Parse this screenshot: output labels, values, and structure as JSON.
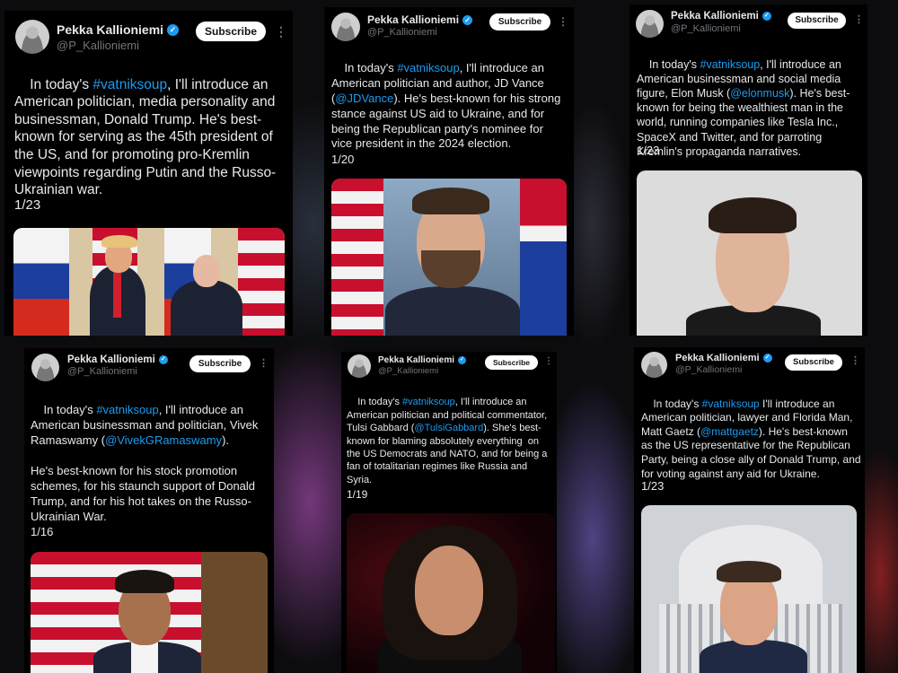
{
  "author": {
    "name": "Pekka Kallioniemi",
    "handle": "@P_Kallioniemi"
  },
  "subscribe_label": "Subscribe",
  "more_icon": "⋮",
  "verified_icon": "✓",
  "colors": {
    "link": "#1d9bf0",
    "card_bg": "#000000",
    "text": "#e7e9ea",
    "muted": "#71767b"
  },
  "posts": [
    {
      "pre": "In today's ",
      "hashtag": "#vatniksoup",
      "post": ", I'll introduce an American politician, media personality and businessman, Donald Trump. He's best-known for serving as the 45th president of the US, and for promoting pro-Kremlin viewpoints regarding Putin and the Russo-Ukrainian war.",
      "mention": "",
      "post2": "",
      "count": "1/23"
    },
    {
      "pre": "In today's ",
      "hashtag": "#vatniksoup",
      "post": ", I'll introduce an American politician and author, JD Vance (",
      "mention": "@JDVance",
      "post2": "). He's best-known for his strong stance against US aid to Ukraine, and for being the Republican party's nominee for vice president in the 2024 election.",
      "count": "1/20"
    },
    {
      "pre": "In today's ",
      "hashtag": "#vatniksoup",
      "post": ", I'll introduce an American businessman and social media figure, Elon Musk (",
      "mention": "@elonmusk",
      "post2": "). He's best-known for being the wealthiest man in the world, running companies like Tesla Inc., SpaceX and Twitter, and for parroting Kremlin's propaganda narratives.",
      "count": "1/23"
    },
    {
      "pre": "In today's ",
      "hashtag": "#vatniksoup",
      "post": ", I'll introduce an American businessman and politician, Vivek Ramaswamy (",
      "mention": "@VivekGRamaswamy",
      "post2": ").\n\nHe's best-known for his stock promotion schemes, for his staunch support of Donald Trump, and for his hot takes on the Russo-Ukrainian War.",
      "count": "1/16"
    },
    {
      "pre": "In today's ",
      "hashtag": "#vatniksoup",
      "post": ", I'll introduce an American politician and political commentator, Tulsi Gabbard (",
      "mention": "@TulsiGabbard",
      "post2": "). She's best-known for blaming absolutely everything  on the US Democrats and NATO, and for being a fan of totalitarian regimes like Russia and Syria.",
      "count": "1/19"
    },
    {
      "pre": "In today's ",
      "hashtag": "#vatniksoup",
      "post": " I'll introduce an American politician, lawyer and Florida Man, Matt Gaetz (",
      "mention": "@mattgaetz",
      "post2": "). He's best-known as the US representative for the Republican Party, being a close ally of Donald Trump, and for voting against any aid for Ukraine.",
      "count": "1/23"
    }
  ]
}
